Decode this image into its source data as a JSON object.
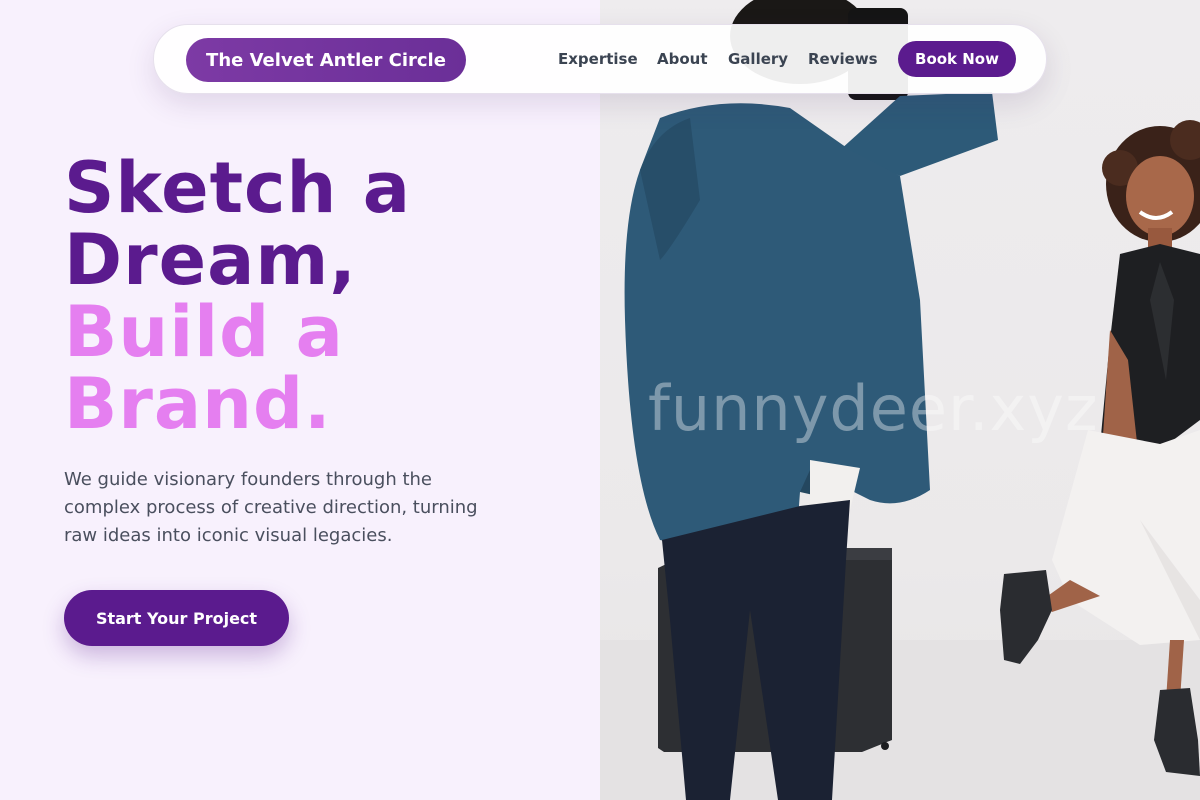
{
  "nav": {
    "brand": "The Velvet Antler Circle",
    "links": [
      "Expertise",
      "About",
      "Gallery",
      "Reviews"
    ],
    "book_label": "Book Now"
  },
  "hero": {
    "line1": "Sketch a",
    "line2": "Dream,",
    "line3": "Build a",
    "line4": "Brand.",
    "lead": "We guide visionary founders through the complex process of creative direction, turning raw ideas into iconic visual legacies.",
    "cta_label": "Start Your Project"
  },
  "photo": {
    "watermark": "funnydeer.xyz"
  },
  "colors": {
    "primary": "#5b1b8e",
    "accent": "#e57ff0",
    "background": "#f8f1fd"
  }
}
